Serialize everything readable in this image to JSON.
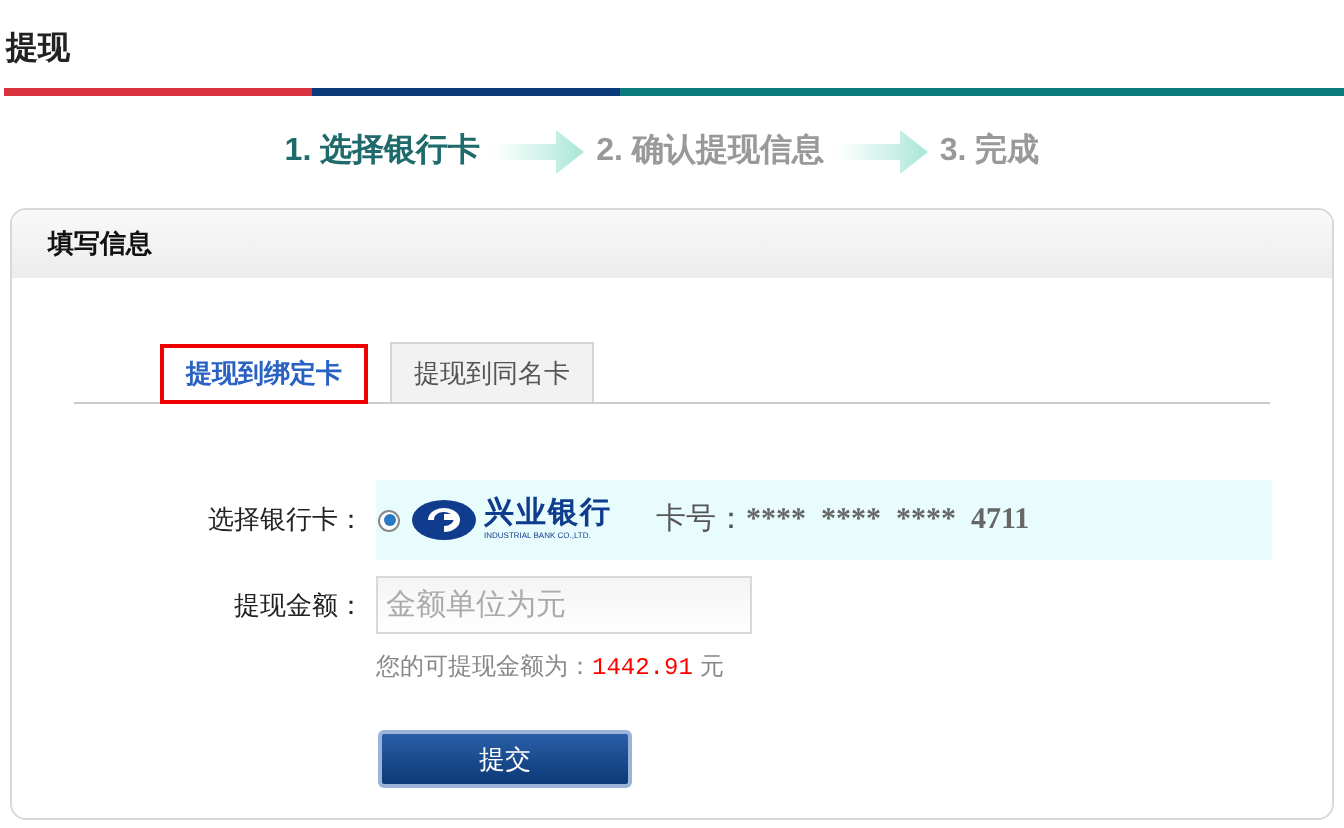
{
  "page_title": "提现",
  "steps": [
    {
      "label": "1. 选择银行卡",
      "selected": true
    },
    {
      "label": "2. 确认提现信息",
      "selected": false
    },
    {
      "label": "3. 完成",
      "selected": false
    }
  ],
  "panel": {
    "title": "填写信息",
    "tabs": [
      {
        "label": "提现到绑定卡",
        "selected": true
      },
      {
        "label": "提现到同名卡",
        "selected": false
      }
    ],
    "card_row": {
      "label": "选择银行卡：",
      "selected": true,
      "bank_name": "兴业银行",
      "bank_name_en": "INDUSTRIAL BANK CO.,LTD.",
      "card_label": "卡号：",
      "card_number": "**** **** **** 4711"
    },
    "amount_row": {
      "label": "提现金额：",
      "placeholder": "金额单位为元"
    },
    "hint": {
      "prefix": "您的可提现金额为：",
      "amount": "1442.91",
      "unit": "元"
    },
    "submit": "提交"
  }
}
